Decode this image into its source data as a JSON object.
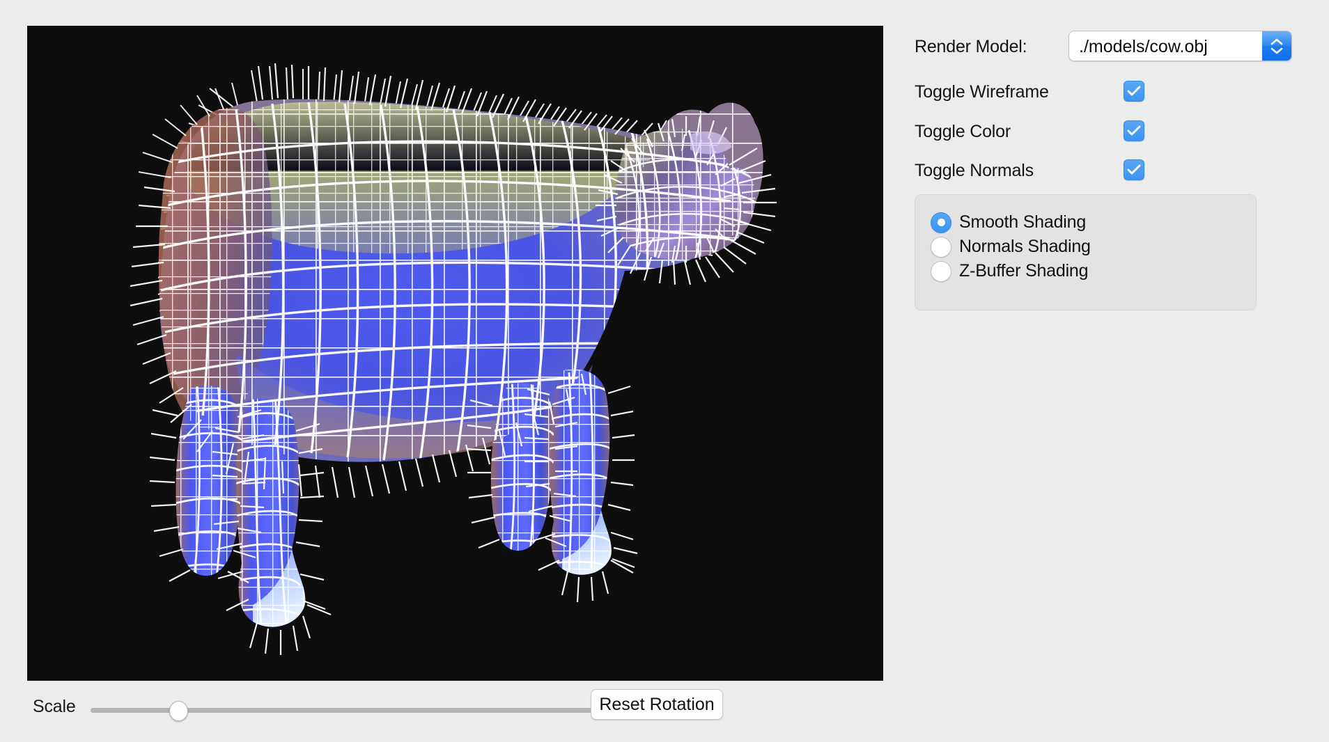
{
  "app": {
    "background_color": "#ececec",
    "canvas_background": "#0e0e0e"
  },
  "viewport": {
    "name": "render-viewport",
    "model_label": "cow",
    "shading_mode": "Smooth Shading",
    "wireframe_color": "#ffffff",
    "normals_color": "#ffffff",
    "surface_colors": {
      "body_blue": "#4a56e8",
      "back_olive": "#a8ad6a",
      "shoulder_brown": "#a8secondary",
      "shoulder": "#a2644f",
      "head_purple": "#b79ede",
      "highlight": "#cfe0ff"
    }
  },
  "controls": {
    "render_model": {
      "label": "Render Model:",
      "value": "./models/cow.obj"
    },
    "toggles": [
      {
        "label": "Toggle Wireframe",
        "checked": true
      },
      {
        "label": "Toggle Color",
        "checked": true
      },
      {
        "label": "Toggle Normals",
        "checked": true
      }
    ],
    "shading_options": [
      {
        "label": "Smooth Shading",
        "selected": true
      },
      {
        "label": "Normals Shading",
        "selected": false
      },
      {
        "label": "Z-Buffer Shading",
        "selected": false
      }
    ],
    "checkbox_color": "#3d95f2",
    "radio_color": "#3b93f2"
  },
  "bottom": {
    "scale_label": "Scale",
    "scale_percent": 13,
    "reset_button": "Reset Rotation"
  }
}
